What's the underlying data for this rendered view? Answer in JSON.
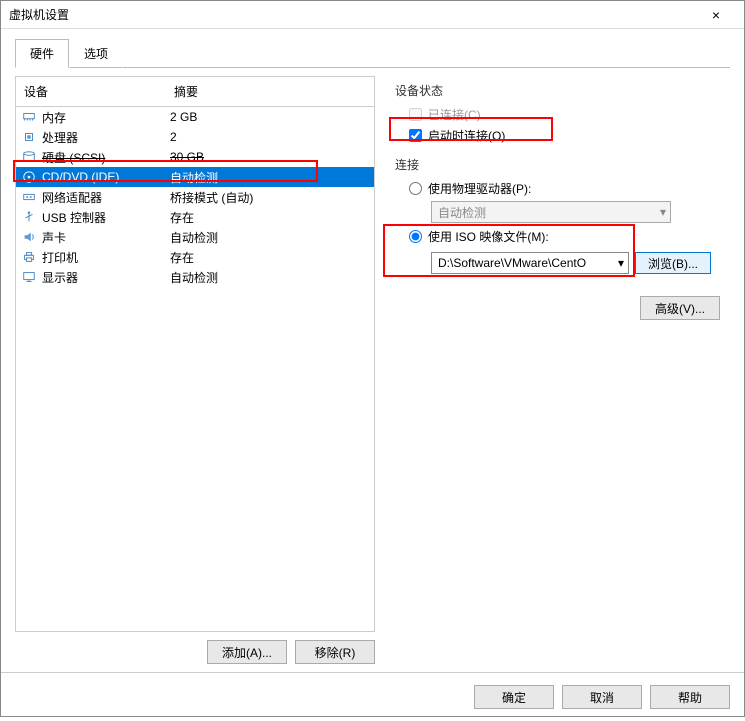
{
  "window": {
    "title": "虚拟机设置",
    "close": "×"
  },
  "tabs": {
    "hardware": "硬件",
    "options": "选项"
  },
  "grid": {
    "colDevice": "设备",
    "colSummary": "摘要",
    "rows": [
      {
        "icon": "memory",
        "dev": "内存",
        "sum": "2 GB"
      },
      {
        "icon": "cpu",
        "dev": "处理器",
        "sum": "2"
      },
      {
        "icon": "disk",
        "dev": "硬盘 (SCSI)",
        "sum": "30 GB",
        "strike": true
      },
      {
        "icon": "cd",
        "dev": "CD/DVD (IDE)",
        "sum": "自动检测",
        "selected": true
      },
      {
        "icon": "nic",
        "dev": "网络适配器",
        "sum": "桥接模式 (自动)"
      },
      {
        "icon": "usb",
        "dev": "USB 控制器",
        "sum": "存在"
      },
      {
        "icon": "sound",
        "dev": "声卡",
        "sum": "自动检测"
      },
      {
        "icon": "printer",
        "dev": "打印机",
        "sum": "存在"
      },
      {
        "icon": "display",
        "dev": "显示器",
        "sum": "自动检测"
      }
    ]
  },
  "leftButtons": {
    "add": "添加(A)...",
    "remove": "移除(R)"
  },
  "status": {
    "legend": "设备状态",
    "connected": "已连接(C)",
    "connectOnPower": "启动时连接(O)"
  },
  "connection": {
    "legend": "连接",
    "physical": "使用物理驱动器(P):",
    "physicalCombo": "自动检测",
    "isoFile": "使用 ISO 映像文件(M):",
    "isoPath": "D:\\Software\\VMware\\CentO",
    "browse": "浏览(B)...",
    "advanced": "高级(V)..."
  },
  "footer": {
    "ok": "确定",
    "cancel": "取消",
    "help": "帮助"
  }
}
